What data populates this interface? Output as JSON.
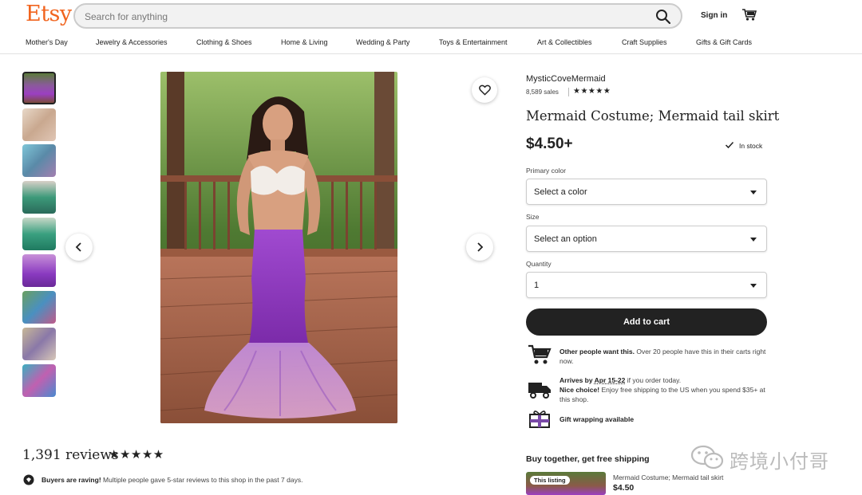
{
  "header": {
    "logo": "Etsy",
    "search_placeholder": "Search for anything",
    "signin_label": "Sign in",
    "search_icon": "search-icon",
    "cart_icon": "cart-icon"
  },
  "categories": [
    "Mother's Day",
    "Jewelry & Accessories",
    "Clothing & Shoes",
    "Home & Living",
    "Wedding & Party",
    "Toys & Entertainment",
    "Art & Collectibles",
    "Craft Supplies",
    "Gifts & Gift Cards"
  ],
  "listing": {
    "shop_name": "MysticCoveMermaid",
    "sales": "8,589 sales",
    "shop_rating_stars": "★★★★★",
    "title": "Mermaid Costume; Mermaid tail skirt",
    "price": "$4.50+",
    "stock": "In stock",
    "primary_color_label": "Primary color",
    "primary_color_value": "Select a color",
    "size_label": "Size",
    "size_value": "Select an option",
    "quantity_label": "Quantity",
    "quantity_value": "1",
    "add_to_cart": "Add to cart"
  },
  "info": {
    "demand_bold": "Other people want this.",
    "demand_text": " Over 20 people have this in their carts right now.",
    "arrives_prefix": "Arrives by ",
    "arrives_date": "Apr 15-22",
    "arrives_suffix": " if you order today.",
    "shipping_bold": "Nice choice!",
    "shipping_text": " Enjoy free shipping to the US when you spend $35+ at this shop.",
    "gift_text": "Gift wrapping available"
  },
  "reviews": {
    "count_label": "1,391 reviews",
    "stars": "★★★★★",
    "raving_bold": "Buyers are raving!",
    "raving_text": " Multiple people gave 5-star reviews to this shop in the past 7 days."
  },
  "bundle": {
    "title": "Buy together, get free shipping",
    "badge": "This listing",
    "item_name": "Mermaid Costume; Mermaid tail skirt",
    "item_price": "$4.50"
  },
  "watermark": {
    "text": "跨境小付哥"
  },
  "colors": {
    "brand": "#F1641E",
    "primary_button": "#222222",
    "skirt_purple": "#8E3FB8"
  }
}
